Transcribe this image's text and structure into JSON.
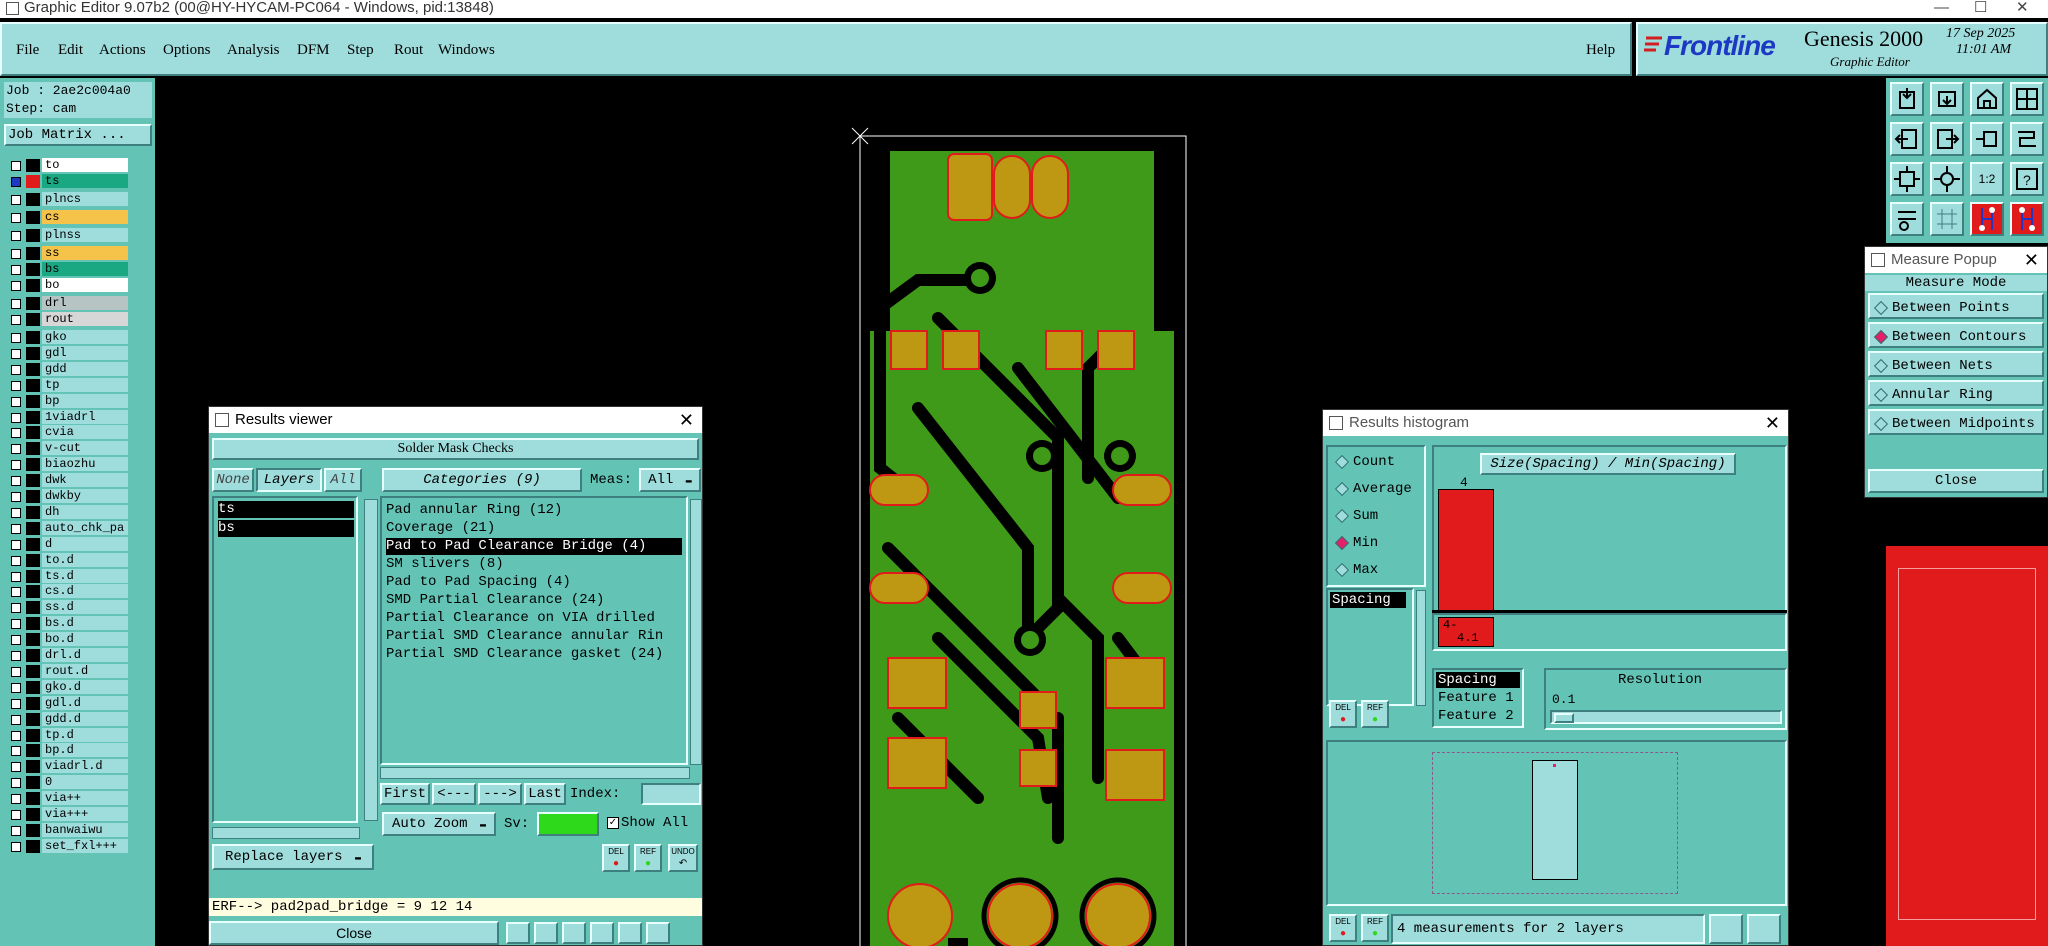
{
  "window": {
    "title": "Graphic Editor 9.07b2 (00@HY-HYCAM-PC064 - Windows, pid:13848)"
  },
  "menu": {
    "items": [
      "File",
      "Edit",
      "Actions",
      "Options",
      "Analysis",
      "DFM",
      "Step",
      "Rout",
      "Windows"
    ],
    "help": "Help"
  },
  "brand": {
    "logo": "Frontline",
    "product": "Genesis 2000",
    "subtitle": "Graphic Editor",
    "date": "17 Sep 2025",
    "time": "11:01 AM"
  },
  "job": {
    "job_line": "Job : 2ae2c004a0",
    "step_line": "Step: cam",
    "matrix_button": "Job Matrix ..."
  },
  "layers": [
    {
      "name": "to",
      "color": "#ffffff",
      "swatch": "#000000"
    },
    {
      "name": "ts",
      "color": "#1aa882",
      "swatch": "#e11b1b",
      "active": true
    },
    {
      "name": "plncs",
      "color": "#9fdcdc",
      "swatch": "#000000"
    },
    {
      "name": "cs",
      "color": "#f5c24a",
      "swatch": "#000000"
    },
    {
      "name": "plnss",
      "color": "#9fdcdc",
      "swatch": "#000000"
    },
    {
      "name": "ss",
      "color": "#f5c24a",
      "swatch": "#000000"
    },
    {
      "name": "bs",
      "color": "#1aa882",
      "swatch": "#000000"
    },
    {
      "name": "bo",
      "color": "#ffffff",
      "swatch": "#000000"
    },
    {
      "name": "drl",
      "color": "#b7c4c4",
      "swatch": "#000000"
    },
    {
      "name": "rout",
      "color": "#d7d7d7",
      "swatch": "#000000"
    },
    {
      "name": "gko"
    },
    {
      "name": "gdl"
    },
    {
      "name": "gdd"
    },
    {
      "name": "tp"
    },
    {
      "name": "bp"
    },
    {
      "name": "1viadrl"
    },
    {
      "name": "cvia"
    },
    {
      "name": "v-cut"
    },
    {
      "name": "biaozhu"
    },
    {
      "name": "dwk"
    },
    {
      "name": "dwkby"
    },
    {
      "name": "dh"
    },
    {
      "name": "auto_chk_pa"
    },
    {
      "name": "d"
    },
    {
      "name": "to.d"
    },
    {
      "name": "ts.d"
    },
    {
      "name": "cs.d"
    },
    {
      "name": "ss.d"
    },
    {
      "name": "bs.d"
    },
    {
      "name": "bo.d"
    },
    {
      "name": "drl.d"
    },
    {
      "name": "rout.d"
    },
    {
      "name": "gko.d"
    },
    {
      "name": "gdl.d"
    },
    {
      "name": "gdd.d"
    },
    {
      "name": "tp.d"
    },
    {
      "name": "bp.d"
    },
    {
      "name": "viadrl.d"
    },
    {
      "name": "0"
    },
    {
      "name": "via++"
    },
    {
      "name": "via+++"
    },
    {
      "name": "banwaiwu"
    },
    {
      "name": "set_fxl+++"
    }
  ],
  "results_viewer": {
    "title": "Results viewer",
    "header": "Solder Mask Checks",
    "none_btn": "None",
    "layers_btn": "Layers",
    "all_btn": "All",
    "categories_btn": "Categories (9)",
    "meas_label": "Meas:",
    "meas_value": "All",
    "layer_list": [
      "ts",
      "bs"
    ],
    "categories": [
      "Pad annular Ring (12)",
      "Coverage (21)",
      "Pad to Pad Clearance Bridge (4)",
      "SM slivers (8)",
      "Pad to Pad Spacing (4)",
      "SMD Partial Clearance (24)",
      "Partial Clearance on VIA drilled",
      "Partial SMD Clearance annular Rin",
      "Partial SMD Clearance gasket (24)"
    ],
    "selected_category": 2,
    "first_btn": "First",
    "prev_btn": "<---",
    "next_btn": "--->",
    "last_btn": "Last",
    "index_label": "Index:",
    "auto_zoom": "Auto Zoom",
    "sv_label": "Sv:",
    "show_all": "Show All",
    "replace_layers": "Replace layers",
    "del": "DEL",
    "ref": "REF",
    "undo": "UNDO",
    "erf_line": "ERF--> pad2pad_bridge = 9 12 14",
    "close": "Close"
  },
  "histogram": {
    "title": "Results histogram",
    "modes": [
      "Count",
      "Average",
      "Sum",
      "Min",
      "Max"
    ],
    "selected_mode": "Min",
    "list": [
      "Spacing"
    ],
    "chart_title": "Size(Spacing) / Min(Spacing)",
    "bar_top_label": "4",
    "bar_bottom_label_1": "4-",
    "bar_bottom_label_2": "4.1",
    "sort_list": [
      "Spacing",
      "Feature 1",
      "Feature 2"
    ],
    "resolution_label": "Resolution",
    "resolution_value": "0.1",
    "status": "4 measurements for 2 layers",
    "del": "DEL",
    "ref": "REF"
  },
  "measure": {
    "title": "Measure Popup",
    "mode_label": "Measure Mode",
    "options": [
      "Between Points",
      "Between Contours",
      "Between Nets",
      "Annular Ring",
      "Between Midpoints"
    ],
    "selected": "Between Contours",
    "close": "Close"
  },
  "colors": {
    "panel": "#9fdcdc",
    "panel_dark": "#63c4b6",
    "board": "#3f9a19",
    "pad": "#bf9813",
    "pad_outline": "#e11b1b",
    "black": "#000000"
  }
}
